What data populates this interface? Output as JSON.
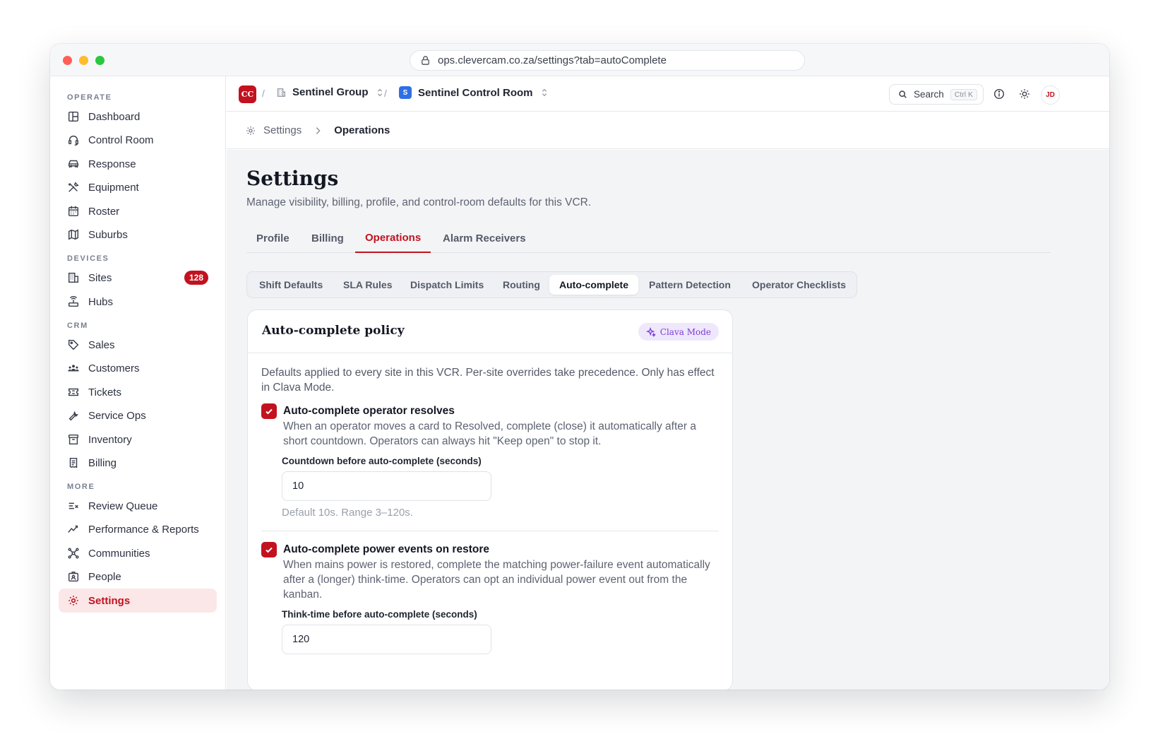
{
  "browser": {
    "url": "ops.clevercam.co.za/settings?tab=autoComplete"
  },
  "sidebar": {
    "sections": [
      {
        "label": "OPERATE",
        "items": [
          {
            "label": "Dashboard",
            "icon": "layout-icon"
          },
          {
            "label": "Control Room",
            "icon": "headset-icon"
          },
          {
            "label": "Response",
            "icon": "car-icon"
          },
          {
            "label": "Equipment",
            "icon": "tools-icon"
          },
          {
            "label": "Roster",
            "icon": "calendar-icon"
          },
          {
            "label": "Suburbs",
            "icon": "map-icon"
          }
        ]
      },
      {
        "label": "DEVICES",
        "items": [
          {
            "label": "Sites",
            "icon": "building-icon",
            "badge": "128"
          },
          {
            "label": "Hubs",
            "icon": "router-icon"
          }
        ]
      },
      {
        "label": "CRM",
        "items": [
          {
            "label": "Sales",
            "icon": "tag-icon"
          },
          {
            "label": "Customers",
            "icon": "users-icon"
          },
          {
            "label": "Tickets",
            "icon": "ticket-icon"
          },
          {
            "label": "Service Ops",
            "icon": "wrench-icon"
          },
          {
            "label": "Inventory",
            "icon": "archive-icon"
          },
          {
            "label": "Billing",
            "icon": "receipt-icon"
          }
        ]
      },
      {
        "label": "MORE",
        "items": [
          {
            "label": "Review Queue",
            "icon": "list-check-icon"
          },
          {
            "label": "Performance & Reports",
            "icon": "trend-icon"
          },
          {
            "label": "Communities",
            "icon": "network-icon"
          },
          {
            "label": "People",
            "icon": "id-badge-icon"
          },
          {
            "label": "Settings",
            "icon": "gear-icon",
            "active": true
          }
        ]
      }
    ]
  },
  "topbar": {
    "org_logo": "CC",
    "org_name": "Sentinel Group",
    "room_chip": "S",
    "room_name": "Sentinel Control Room",
    "search_label": "Search",
    "search_shortcut": "Ctrl K",
    "avatar_initials": "JD"
  },
  "breadcrumb": {
    "parent": "Settings",
    "current": "Operations"
  },
  "page": {
    "title": "Settings",
    "subtitle": "Manage visibility, billing, profile, and control-room defaults for this VCR.",
    "tabs": [
      "Profile",
      "Billing",
      "Operations",
      "Alarm Receivers"
    ],
    "active_tab": "Operations",
    "subtabs": [
      "Shift Defaults",
      "SLA Rules",
      "Dispatch Limits",
      "Routing",
      "Auto-complete",
      "Pattern Detection",
      "Operator Checklists"
    ],
    "active_subtab": "Auto-complete"
  },
  "card": {
    "title": "Auto-complete policy",
    "mode_pill": "Clava Mode",
    "description": "Defaults applied to every site in this VCR. Per-site overrides take precedence. Only has effect in Clava Mode.",
    "options": [
      {
        "checked": true,
        "title": "Auto-complete operator resolves",
        "description": "When an operator moves a card to Resolved, complete (close) it automatically after a short countdown. Operators can always hit \"Keep open\" to stop it.",
        "field_label": "Countdown before auto-complete (seconds)",
        "field_value": "10",
        "hint": "Default 10s. Range 3–120s."
      },
      {
        "checked": true,
        "title": "Auto-complete power events on restore",
        "description": "When mains power is restored, complete the matching power-failure event automatically after a (longer) think-time. Operators can opt an individual power event out from the kanban.",
        "field_label": "Think-time before auto-complete (seconds)",
        "field_value": "120"
      }
    ]
  },
  "colors": {
    "accent": "#c2121f",
    "accent_soft": "#fbe7e8",
    "clava_purple": "#7a3fd1",
    "room_blue": "#2f6fe6"
  }
}
